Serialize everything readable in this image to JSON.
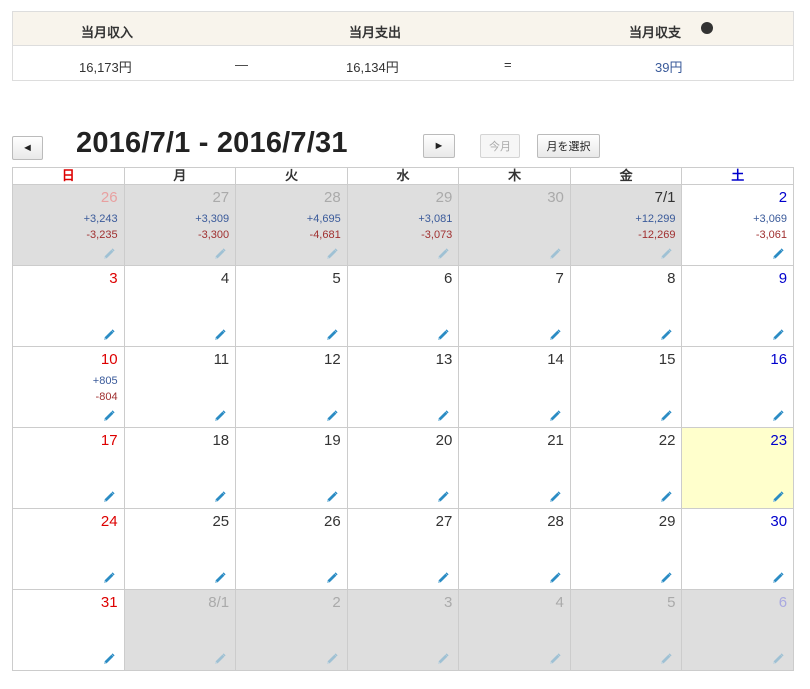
{
  "summary": {
    "income_label": "当月収入",
    "expense_label": "当月支出",
    "balance_label": "当月収支",
    "help_icon": "?",
    "income_value": "16,173円",
    "minus_sign": "—",
    "expense_value": "16,134円",
    "equals_sign": "=",
    "balance_value": "39円"
  },
  "nav": {
    "prev": "◄",
    "next": "►",
    "title": "2016/7/1 - 2016/7/31",
    "this_month": "今月",
    "select_month": "月を選択"
  },
  "weekdays": [
    "日",
    "月",
    "火",
    "水",
    "木",
    "金",
    "土"
  ],
  "weeks": [
    [
      {
        "label": "26",
        "other": true,
        "inc": "+3,243",
        "exp": "-3,235"
      },
      {
        "label": "27",
        "other": true,
        "inc": "+3,309",
        "exp": "-3,300"
      },
      {
        "label": "28",
        "other": true,
        "inc": "+4,695",
        "exp": "-4,681"
      },
      {
        "label": "29",
        "other": true,
        "inc": "+3,081",
        "exp": "-3,073"
      },
      {
        "label": "30",
        "other": true
      },
      {
        "label": "7/1",
        "other": true,
        "cur": true,
        "inc": "+12,299",
        "exp": "-12,269"
      },
      {
        "label": "2",
        "inc": "+3,069",
        "exp": "-3,061"
      }
    ],
    [
      {
        "label": "3"
      },
      {
        "label": "4"
      },
      {
        "label": "5"
      },
      {
        "label": "6"
      },
      {
        "label": "7"
      },
      {
        "label": "8"
      },
      {
        "label": "9"
      }
    ],
    [
      {
        "label": "10",
        "inc": "+805",
        "exp": "-804"
      },
      {
        "label": "11"
      },
      {
        "label": "12"
      },
      {
        "label": "13"
      },
      {
        "label": "14"
      },
      {
        "label": "15"
      },
      {
        "label": "16"
      }
    ],
    [
      {
        "label": "17"
      },
      {
        "label": "18"
      },
      {
        "label": "19"
      },
      {
        "label": "20"
      },
      {
        "label": "21"
      },
      {
        "label": "22"
      },
      {
        "label": "23",
        "today": true
      }
    ],
    [
      {
        "label": "24"
      },
      {
        "label": "25"
      },
      {
        "label": "26"
      },
      {
        "label": "27"
      },
      {
        "label": "28"
      },
      {
        "label": "29"
      },
      {
        "label": "30"
      }
    ],
    [
      {
        "label": "31"
      },
      {
        "label": "8/1",
        "other": true
      },
      {
        "label": "2",
        "other": true
      },
      {
        "label": "3",
        "other": true
      },
      {
        "label": "4",
        "other": true
      },
      {
        "label": "5",
        "other": true
      },
      {
        "label": "6",
        "other": true
      }
    ]
  ],
  "colors": {
    "sunday": "#dd0000",
    "saturday": "#0000cc",
    "income": "#3a5a9a",
    "expense": "#a03030",
    "today_bg": "#ffffcc",
    "other_month_bg": "#dedede",
    "edit_icon": "#2b8cc4"
  },
  "icons": {
    "edit": "pencil-icon",
    "help": "help-icon"
  }
}
